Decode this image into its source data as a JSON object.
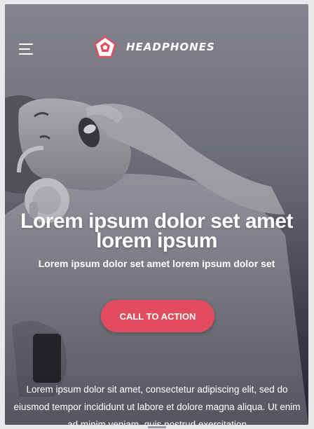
{
  "header": {
    "menu_icon": "hamburger-menu-icon",
    "logo_icon": "pentagon-logo-icon",
    "brand_name": "HEADPHONES"
  },
  "hero": {
    "headline": "Lorem ipsum dolor set amet lorem ipsum",
    "subheadline": "Lorem ipsum dolor set amet lorem ipsum dolor set",
    "cta_label": "CALL TO ACTION",
    "body": "Lorem ipsum dolor sit amet, consectetur adipiscing elit, sed do eiusmod tempor incididunt ut labore et dolore magna aliqua. Ut enim ad minim veniam, quis nostrud exercitation"
  },
  "colors": {
    "accent": "#e34b5e",
    "text": "#ffffff",
    "overlay": "#6e6f78"
  }
}
